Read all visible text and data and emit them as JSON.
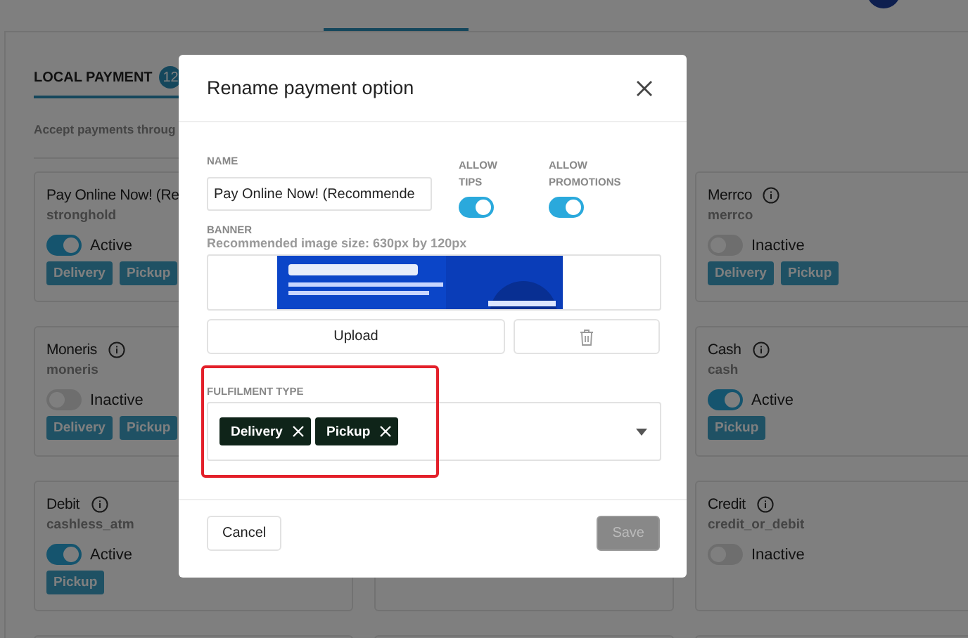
{
  "tabs": [
    {
      "label": "LOCAL PAYMENT",
      "count": "12",
      "selected": true
    }
  ],
  "description": "Accept payments throug",
  "columns": [
    {
      "cards": [
        {
          "name": "Pay Online Now! (Re",
          "code": "stronghold",
          "active": true,
          "status": "Active",
          "tags": [
            "Delivery",
            "Pickup"
          ]
        },
        {
          "name": "Moneris",
          "code": "moneris",
          "active": false,
          "status": "Inactive",
          "tags": [
            "Delivery",
            "Pickup"
          ]
        },
        {
          "name": "Debit",
          "code": "cashless_atm",
          "active": true,
          "status": "Active",
          "tags": [
            "Pickup"
          ]
        }
      ]
    },
    {},
    {
      "cards": [
        {
          "name": "Merrco",
          "code": "merrco",
          "active": false,
          "status": "Inactive",
          "tags": [
            "Delivery",
            "Pickup"
          ]
        },
        {
          "name": "Cash",
          "code": "cash",
          "active": true,
          "status": "Active",
          "tags": [
            "Pickup"
          ]
        },
        {
          "name": "Credit",
          "code": "credit_or_debit",
          "active": false,
          "status": "Inactive"
        }
      ]
    }
  ],
  "modal": {
    "title": "Rename payment option",
    "name_label": "NAME",
    "name_value": "Pay Online Now! (Recommende",
    "switches": [
      {
        "label": "ALLOW TIPS",
        "on": true
      },
      {
        "label": "ALLOW PROMOTIONS",
        "on": true
      }
    ],
    "banner_label": "BANNER",
    "banner_hint": "Recommended image size: 630px by 120px",
    "banner": {
      "kind": "picture"
    },
    "upload_button": "Upload",
    "fulfilment_label": "FULFILMENT TYPE",
    "fulfilment_chips": [
      "Delivery",
      "Pickup"
    ],
    "highlighted": true,
    "cancel_button": "Cancel",
    "save_button": "Save",
    "save_disabled": true
  }
}
